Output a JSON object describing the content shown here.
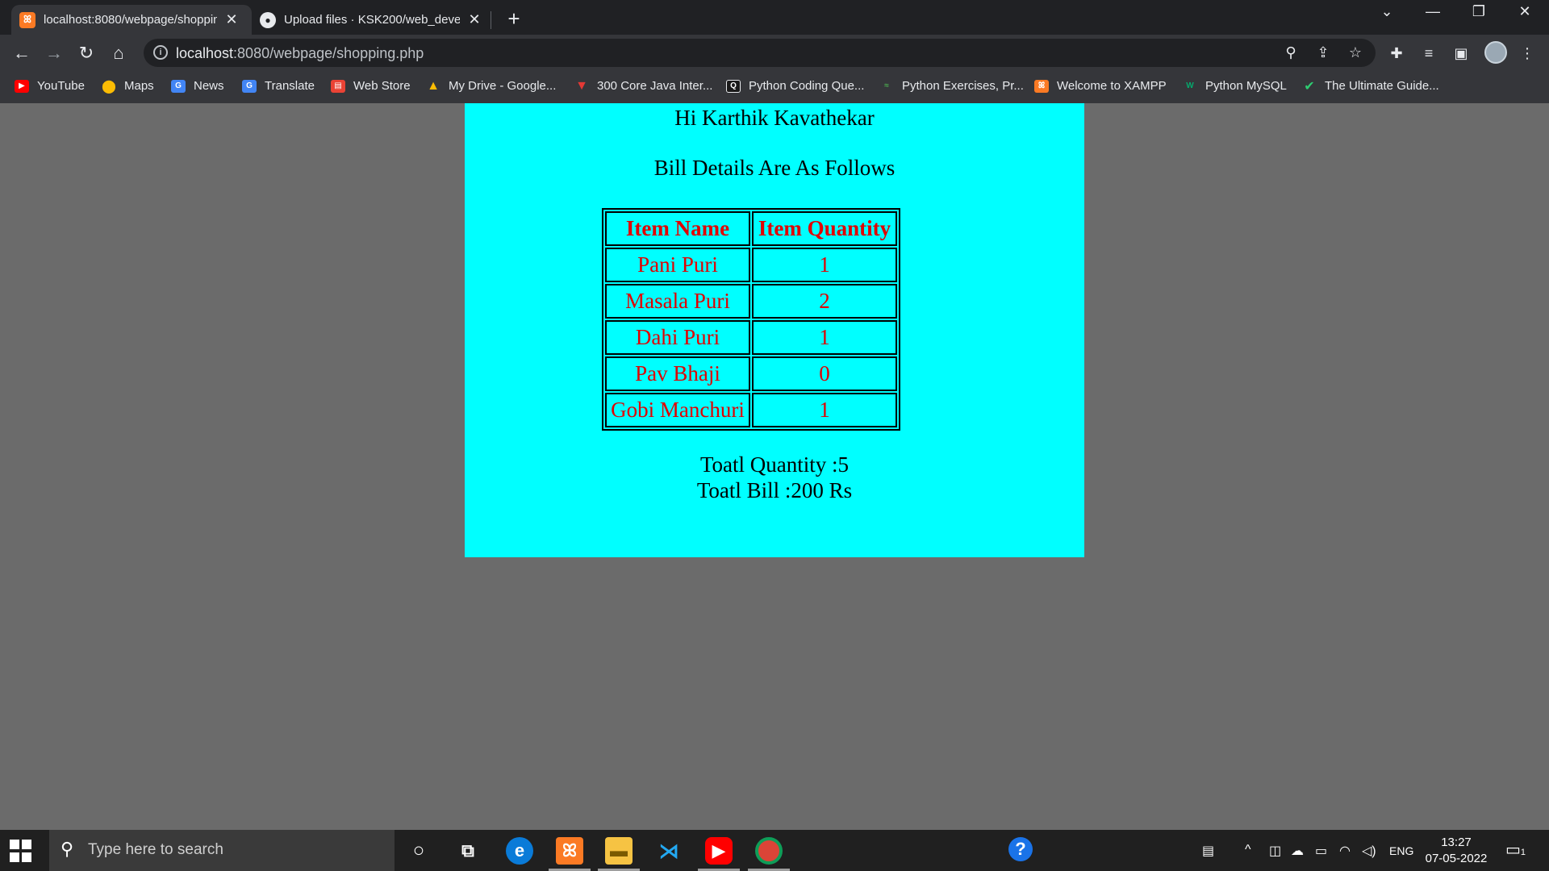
{
  "browser": {
    "tabs": [
      {
        "title": "localhost:8080/webpage/shopping.php",
        "favicon": "xampp-icon",
        "active": true
      },
      {
        "title": "Upload files · KSK200/web_development",
        "favicon": "github-icon",
        "active": false
      }
    ],
    "new_tab_label": "+",
    "address": {
      "host": "localhost",
      "rest": ":8080/webpage/shopping.php"
    },
    "bookmarks": [
      {
        "label": "YouTube",
        "icon": "youtube-icon",
        "color": "#ff0000"
      },
      {
        "label": "Maps",
        "icon": "maps-icon",
        "color": "#34a853"
      },
      {
        "label": "News",
        "icon": "news-icon",
        "color": "#4285f4"
      },
      {
        "label": "Translate",
        "icon": "translate-icon",
        "color": "#4285f4"
      },
      {
        "label": "Web Store",
        "icon": "webstore-icon",
        "color": "#e8eaed"
      },
      {
        "label": "My Drive - Google...",
        "icon": "drive-icon",
        "color": "#fbbc04"
      },
      {
        "label": "300 Core Java Inter...",
        "icon": "java-icon",
        "color": "#e53935"
      },
      {
        "label": "Python Coding Que...",
        "icon": "q-icon",
        "color": "#1a1a1a"
      },
      {
        "label": "Python Exercises, Pr...",
        "icon": "w3-icon",
        "color": "#4caf50"
      },
      {
        "label": "Welcome to XAMPP",
        "icon": "xampp-icon",
        "color": "#fb7a24"
      },
      {
        "label": "Python MySQL",
        "icon": "w3schools-icon",
        "color": "#04aa6d"
      },
      {
        "label": "The Ultimate Guide...",
        "icon": "check-icon",
        "color": "#2ecc71"
      }
    ]
  },
  "page": {
    "greeting": "Hi Karthik Kavathekar",
    "subtitle": "Bill Details Are As Follows",
    "table": {
      "headers": [
        "Item Name",
        "Item Quantity"
      ],
      "rows": [
        [
          "Pani Puri",
          "1"
        ],
        [
          "Masala Puri",
          "2"
        ],
        [
          "Dahi Puri",
          "1"
        ],
        [
          "Pav Bhaji",
          "0"
        ],
        [
          "Gobi Manchuri",
          "1"
        ]
      ]
    },
    "total_quantity": "Toatl Quantity :5",
    "total_bill": "Toatl Bill :200 Rs",
    "panel_color": "#00ffff",
    "text_accent": "#e10000"
  },
  "taskbar": {
    "search_placeholder": "Type here to search",
    "language": "ENG",
    "time": "13:27",
    "date": "07-05-2022",
    "notification_count": "1"
  }
}
